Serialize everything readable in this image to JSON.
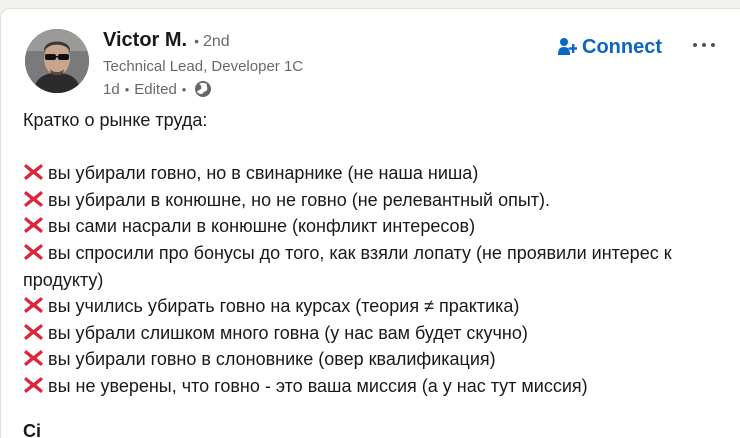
{
  "actor": {
    "name": "Victor M.",
    "separator": "•",
    "degree": "2nd",
    "headline": "Technical Lead, Developer 1C",
    "time": "1d",
    "edited": "Edited",
    "visibility_icon": "globe-icon"
  },
  "actions": {
    "connect_label": "Connect",
    "connect_icon": "add-person-icon",
    "more_icon": "more-horizontal-icon",
    "accent_color": "#0a66c2"
  },
  "post": {
    "intro": "Кратко о рынке труда:",
    "bullet_icon": "red-cross-mark-icon",
    "items": [
      "вы убирали говно, но в свинарнике (не наша ниша)",
      "вы убирали в конюшне, но не говно (не релевантный опыт).",
      "вы сами насрали в конюшне (конфликт интересов)",
      "вы спросили про бонусы до того, как взяли лопату (не проявили интерес к продукту)",
      "вы учились убирать говно на курсах (теория ≠ практика)",
      "вы убрали слишком много говна (у нас вам будет скучно)",
      "вы убирали говно в слоновнике (овер квалификация)",
      "вы не уверены, что говно - это ваша миссия (а у нас тут миссия)"
    ],
    "next_line_partial": "Ci"
  }
}
